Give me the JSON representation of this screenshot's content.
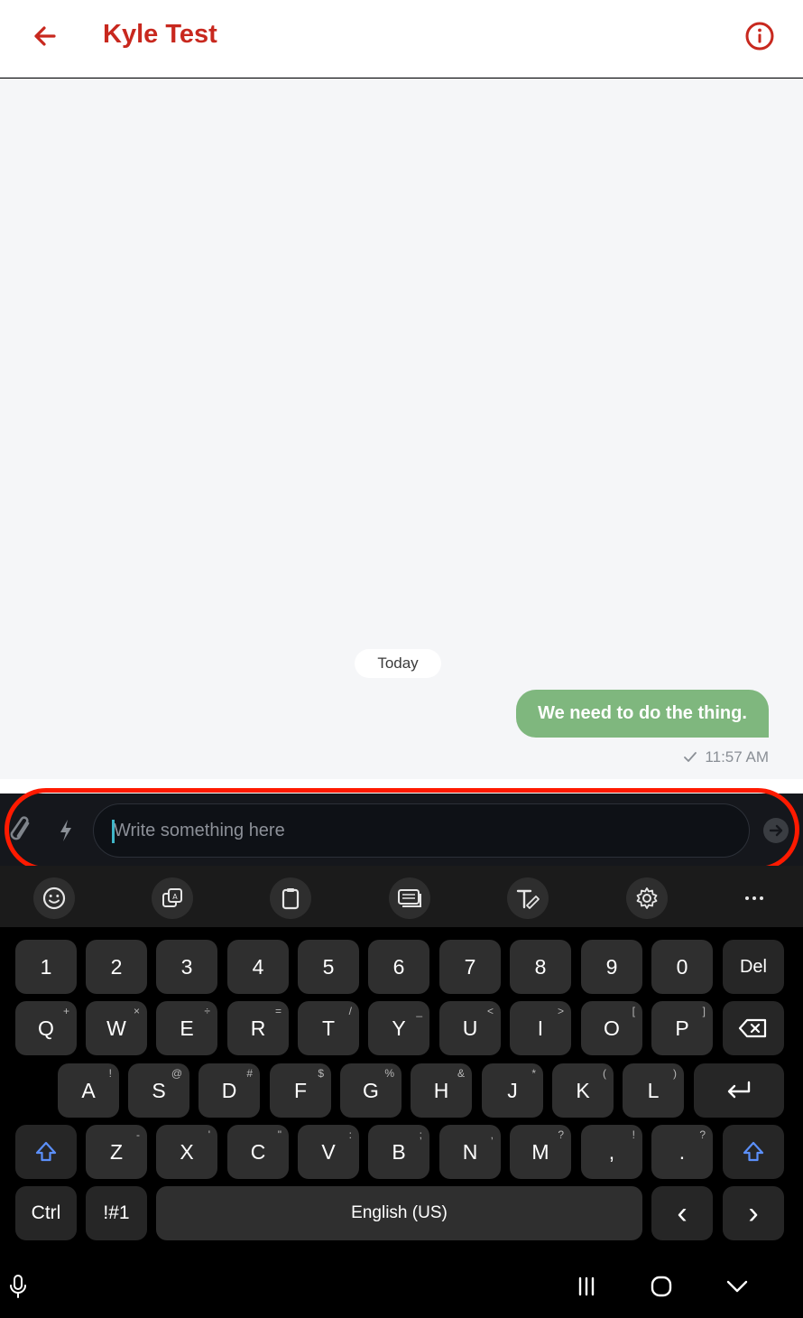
{
  "header": {
    "title": "Kyle Test"
  },
  "chat": {
    "date_separator": "Today",
    "messages": [
      {
        "text": "We need to do the thing.",
        "time": "11:57 AM",
        "direction": "outgoing",
        "status": "sent"
      }
    ]
  },
  "composer": {
    "placeholder": "Write something here"
  },
  "keyboard_toolbar": [
    "emoji-icon",
    "sticker-icon",
    "clipboard-icon",
    "keyboard-mode-icon",
    "handwriting-icon",
    "settings-icon",
    "more-icon"
  ],
  "keyboard": {
    "row_numbers": [
      "1",
      "2",
      "3",
      "4",
      "5",
      "6",
      "7",
      "8",
      "9",
      "0"
    ],
    "del_label": "Del",
    "row_q": [
      {
        "k": "Q",
        "s": "+"
      },
      {
        "k": "W",
        "s": "×"
      },
      {
        "k": "E",
        "s": "÷"
      },
      {
        "k": "R",
        "s": "="
      },
      {
        "k": "T",
        "s": "/"
      },
      {
        "k": "Y",
        "s": "_"
      },
      {
        "k": "U",
        "s": "<"
      },
      {
        "k": "I",
        "s": ">"
      },
      {
        "k": "O",
        "s": "["
      },
      {
        "k": "P",
        "s": "]"
      }
    ],
    "row_a": [
      {
        "k": "A",
        "s": "!"
      },
      {
        "k": "S",
        "s": "@"
      },
      {
        "k": "D",
        "s": "#"
      },
      {
        "k": "F",
        "s": "$"
      },
      {
        "k": "G",
        "s": "%"
      },
      {
        "k": "H",
        "s": "&"
      },
      {
        "k": "J",
        "s": "*"
      },
      {
        "k": "K",
        "s": "("
      },
      {
        "k": "L",
        "s": ")"
      }
    ],
    "row_z": [
      {
        "k": "Z",
        "s": "-"
      },
      {
        "k": "X",
        "s": "'"
      },
      {
        "k": "C",
        "s": "\""
      },
      {
        "k": "V",
        "s": ":"
      },
      {
        "k": "B",
        "s": ";"
      },
      {
        "k": "N",
        "s": ","
      },
      {
        "k": "M",
        "s": "?"
      },
      {
        "k": ",",
        "s": "!"
      },
      {
        "k": ".",
        "s": "?"
      }
    ],
    "ctrl_label": "Ctrl",
    "symbols_label": "!#1",
    "space_label": "English (US)",
    "left_arrow": "‹",
    "right_arrow": "›"
  },
  "colors": {
    "accent": "#c8281e",
    "bubble": "#7fb77e",
    "highlight": "#ff1a00"
  }
}
